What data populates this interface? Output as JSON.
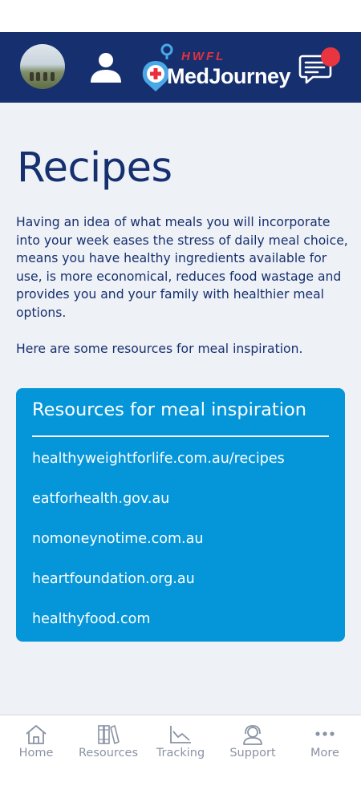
{
  "header": {
    "logo_brand": "HWFL",
    "logo_name": "MedJourney"
  },
  "page": {
    "title": "Recipes",
    "intro": "Having an idea of what meals you will incorporate into your week eases the stress of daily meal choice, means you have healthy ingredients available for use, is more economical, reduces food wastage and provides you and your family with healthier meal options.",
    "intro_2": "Here are some resources for meal inspiration."
  },
  "card": {
    "title": "Resources for meal inspiration",
    "links": [
      "healthyweightforlife.com.au/recipes",
      "eatforhealth.gov.au",
      "nomoneynotime.com.au",
      "heartfoundation.org.au",
      "healthyfood.com"
    ]
  },
  "nav": {
    "items": [
      {
        "label": "Home",
        "icon": "home-icon"
      },
      {
        "label": "Resources",
        "icon": "books-icon"
      },
      {
        "label": "Tracking",
        "icon": "chart-icon"
      },
      {
        "label": "Support",
        "icon": "support-icon"
      },
      {
        "label": "More",
        "icon": "more-icon"
      }
    ]
  },
  "colors": {
    "header_bg": "#16306f",
    "accent_blue": "#0596d9",
    "notification_red": "#e93540",
    "background": "#eef1f6"
  }
}
